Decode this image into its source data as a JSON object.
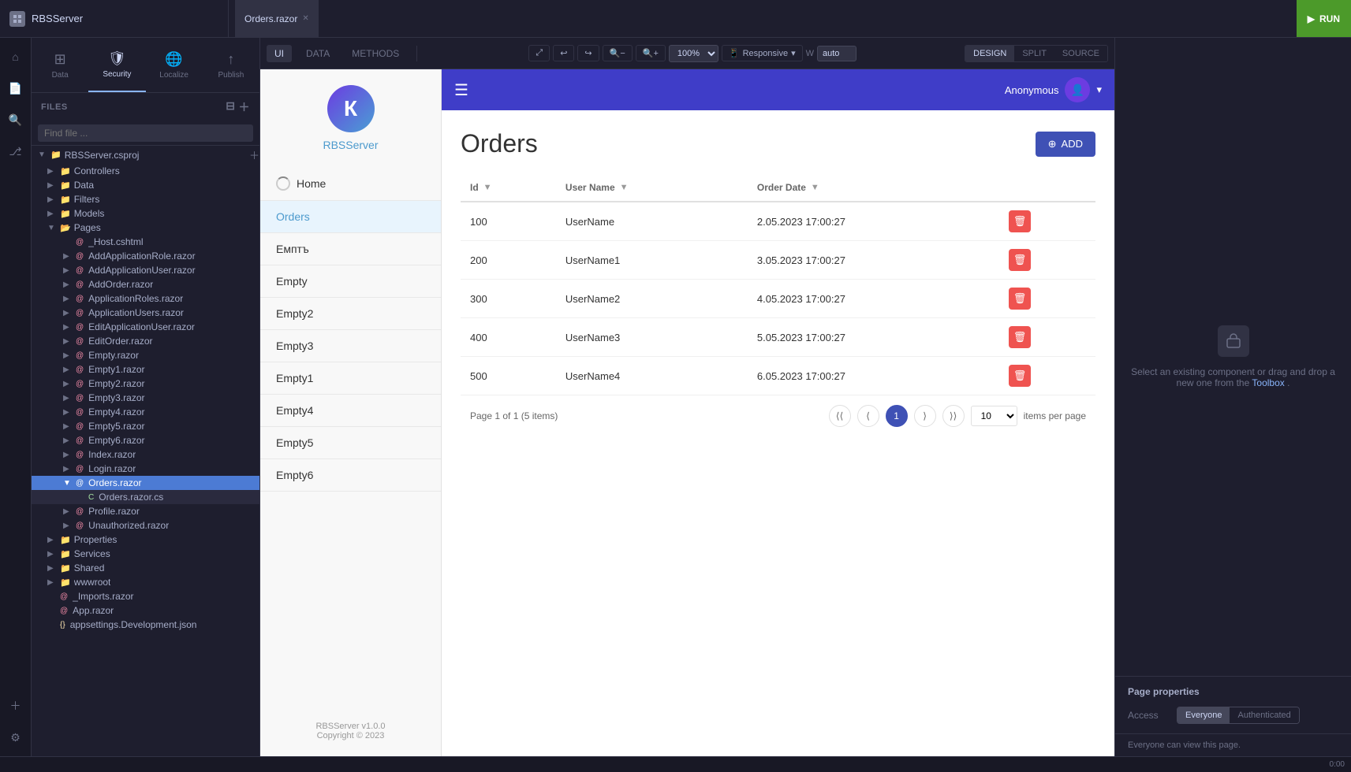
{
  "topbar": {
    "app_name": "RBSServer",
    "tab_label": "Orders.razor",
    "run_label": "RUN"
  },
  "toolbar": {
    "data_label": "Data",
    "security_label": "Security",
    "localize_label": "Localize",
    "publish_label": "Publish"
  },
  "files_panel": {
    "header": "FILES",
    "find_placeholder": "Find file ...",
    "root_item": "RBSServer.csproj",
    "items": [
      {
        "label": "Controllers",
        "type": "folder",
        "indent": 1
      },
      {
        "label": "Data",
        "type": "folder",
        "indent": 1
      },
      {
        "label": "Filters",
        "type": "folder",
        "indent": 1
      },
      {
        "label": "Models",
        "type": "folder",
        "indent": 1
      },
      {
        "label": "Pages",
        "type": "folder",
        "indent": 1,
        "expanded": true
      },
      {
        "label": "_Host.cshtml",
        "type": "cshtml",
        "indent": 2
      },
      {
        "label": "AddApplicationRole.razor",
        "type": "razor",
        "indent": 2
      },
      {
        "label": "AddApplicationUser.razor",
        "type": "razor",
        "indent": 2
      },
      {
        "label": "AddOrder.razor",
        "type": "razor",
        "indent": 2
      },
      {
        "label": "ApplicationRoles.razor",
        "type": "razor",
        "indent": 2
      },
      {
        "label": "ApplicationUsers.razor",
        "type": "razor",
        "indent": 2
      },
      {
        "label": "EditApplicationUser.razor",
        "type": "razor",
        "indent": 2
      },
      {
        "label": "EditOrder.razor",
        "type": "razor",
        "indent": 2
      },
      {
        "label": "Empty.razor",
        "type": "razor",
        "indent": 2
      },
      {
        "label": "Empty1.razor",
        "type": "razor",
        "indent": 2
      },
      {
        "label": "Empty2.razor",
        "type": "razor",
        "indent": 2
      },
      {
        "label": "Empty3.razor",
        "type": "razor",
        "indent": 2
      },
      {
        "label": "Empty4.razor",
        "type": "razor",
        "indent": 2
      },
      {
        "label": "Empty5.razor",
        "type": "razor",
        "indent": 2
      },
      {
        "label": "Empty6.razor",
        "type": "razor",
        "indent": 2
      },
      {
        "label": "Index.razor",
        "type": "razor",
        "indent": 2
      },
      {
        "label": "Login.razor",
        "type": "razor",
        "indent": 2
      },
      {
        "label": "Orders.razor",
        "type": "razor",
        "indent": 2,
        "selected": true
      },
      {
        "label": "Orders.razor.cs",
        "type": "cs",
        "indent": 3
      },
      {
        "label": "Profile.razor",
        "type": "razor",
        "indent": 2
      },
      {
        "label": "Unauthorized.razor",
        "type": "razor",
        "indent": 2
      },
      {
        "label": "Properties",
        "type": "folder",
        "indent": 1
      },
      {
        "label": "Services",
        "type": "folder",
        "indent": 1
      },
      {
        "label": "Shared",
        "type": "folder",
        "indent": 1
      },
      {
        "label": "wwwroot",
        "type": "folder",
        "indent": 1
      },
      {
        "label": "_Imports.razor",
        "type": "razor",
        "indent": 1
      },
      {
        "label": "App.razor",
        "type": "razor",
        "indent": 1
      },
      {
        "label": "appsettings.Development.json",
        "type": "json",
        "indent": 1
      }
    ]
  },
  "design_tabs": [
    "UI",
    "DATA",
    "METHODS"
  ],
  "toolbar_controls": {
    "zoom": "100%",
    "responsive": "Responsive",
    "w_label": "W",
    "w_value": "auto"
  },
  "design_mode_tabs": [
    "DESIGN",
    "SPLIT",
    "SOURCE"
  ],
  "preview": {
    "logo_text": "К",
    "brand_name": "RBSServer",
    "nav_items": [
      "Home",
      "Orders",
      "Емптъ",
      "Empty",
      "Empty2",
      "Empty3",
      "Empty1",
      "Empty4",
      "Empty5",
      "Empty6"
    ],
    "active_nav": "Orders",
    "header_user": "Anonymous",
    "footer_brand": "RBSServer v1.0.0",
    "footer_copy": "Copyright © 2023",
    "page_title": "Orders",
    "add_button": "ADD",
    "table": {
      "columns": [
        "Id",
        "User Name",
        "Order Date",
        ""
      ],
      "rows": [
        {
          "id": "100",
          "user_name": "UserName",
          "order_date": "2.05.2023 17:00:27"
        },
        {
          "id": "200",
          "user_name": "UserName1",
          "order_date": "3.05.2023 17:00:27"
        },
        {
          "id": "300",
          "user_name": "UserName2",
          "order_date": "4.05.2023 17:00:27"
        },
        {
          "id": "400",
          "user_name": "UserName3",
          "order_date": "5.05.2023 17:00:27"
        },
        {
          "id": "500",
          "user_name": "UserName4",
          "order_date": "6.05.2023 17:00:27"
        }
      ]
    },
    "pagination": {
      "info": "Page 1 of 1 (5 items)",
      "current_page": "1",
      "per_page": "10",
      "items_per_page_label": "items per page"
    }
  },
  "right_panel": {
    "empty_text": "Select an existing component or drag and drop a new one from the",
    "toolbox_link": "Toolbox",
    "toolbox_period": ".",
    "page_properties_title": "Page properties",
    "access_label": "Access",
    "access_tabs": [
      "Everyone",
      "Authenticated"
    ],
    "active_access": "Everyone",
    "everyone_note": "Everyone can view this page."
  },
  "status_bar": {
    "time": "0:00"
  }
}
